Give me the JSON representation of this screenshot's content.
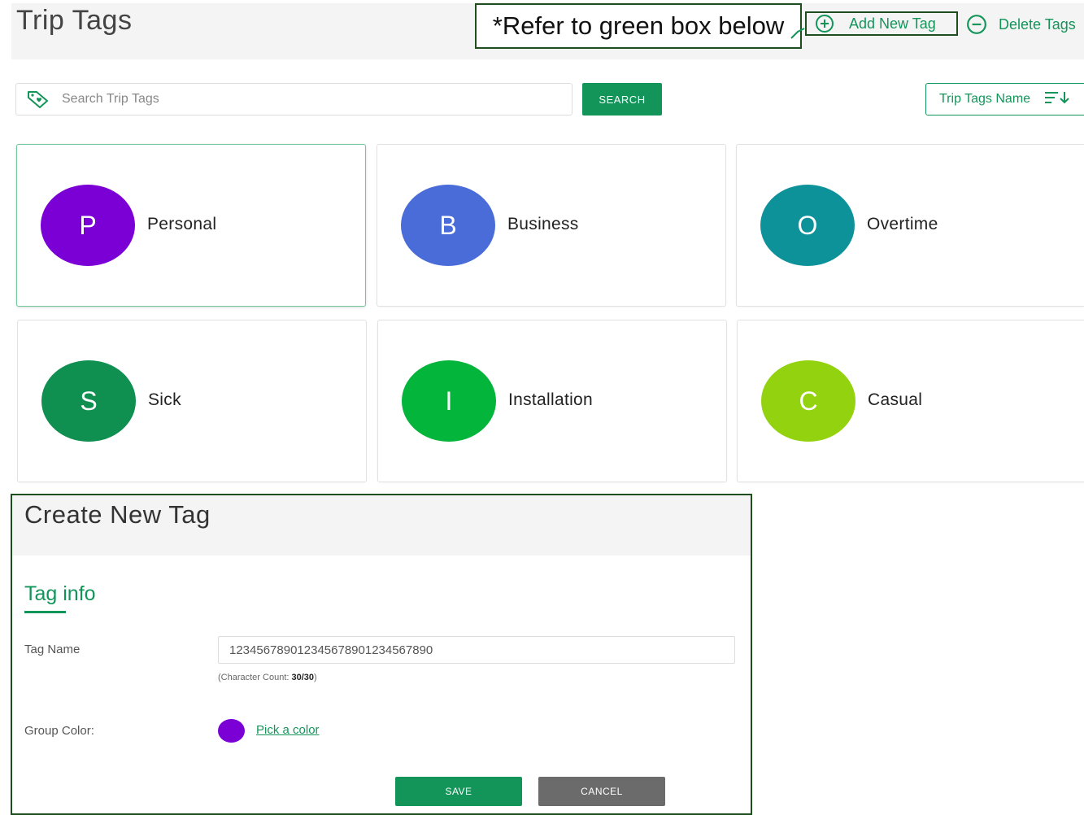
{
  "header": {
    "title": "Trip Tags",
    "callout": "*Refer to green box below",
    "add_tag_label": "Add New Tag",
    "delete_tags_label": "Delete Tags"
  },
  "search": {
    "placeholder": "Search Trip Tags",
    "button_label": "SEARCH"
  },
  "sort": {
    "label": "Trip Tags Name"
  },
  "tags": [
    {
      "initial": "P",
      "name": "Personal",
      "color": "#7a00d6",
      "selected": true
    },
    {
      "initial": "B",
      "name": "Business",
      "color": "#4a6cd8",
      "selected": false
    },
    {
      "initial": "O",
      "name": "Overtime",
      "color": "#0e929a",
      "selected": false
    },
    {
      "initial": "S",
      "name": "Sick",
      "color": "#0f8f50",
      "selected": false
    },
    {
      "initial": "I",
      "name": "Installation",
      "color": "#04b53c",
      "selected": false
    },
    {
      "initial": "C",
      "name": "Casual",
      "color": "#93d20e",
      "selected": false
    }
  ],
  "dialog": {
    "title": "Create New Tag",
    "section_title": "Tag info",
    "tag_name_label": "Tag Name",
    "tag_name_value": "123456789012345678901234567890",
    "char_count_prefix": "(Character Count: ",
    "char_count_value": "30/30",
    "char_count_suffix": ")",
    "group_color_label": "Group Color:",
    "group_color": "#7a00d6",
    "pick_color_label": "Pick a color",
    "save_label": "SAVE",
    "cancel_label": "CANCEL"
  },
  "colors": {
    "accent": "#13955a",
    "callout_border": "#1e4d1e"
  }
}
